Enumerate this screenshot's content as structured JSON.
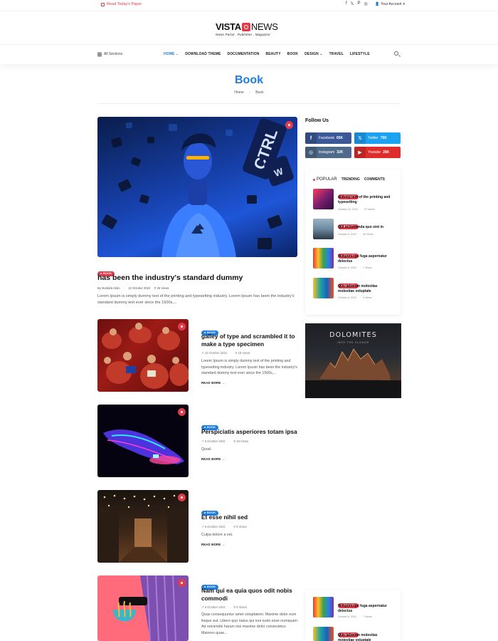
{
  "topbar": {
    "read_paper": "Read Today's Paper",
    "socials": [
      "f",
      "𝕏",
      "P",
      "◎"
    ],
    "account": "Your Account"
  },
  "logo": {
    "brand_left": "VISTA",
    "brand_right": "NEWS",
    "tagline": "News Portal . Publisher . Magazine"
  },
  "nav": {
    "all_sections": "All Sections",
    "items": [
      {
        "label": "HOME",
        "dropdown": true,
        "active": true
      },
      {
        "label": "DOWNLOAD THEME",
        "dropdown": false
      },
      {
        "label": "DOCUMENTATION",
        "dropdown": false
      },
      {
        "label": "BEAUTY",
        "dropdown": false
      },
      {
        "label": "BOOK",
        "dropdown": false
      },
      {
        "label": "DESIGN",
        "dropdown": true
      },
      {
        "label": "TRAVEL",
        "dropdown": false
      },
      {
        "label": "LIFESTYLE",
        "dropdown": false
      }
    ]
  },
  "page": {
    "title": "Book",
    "breadcrumb_home": "Home",
    "breadcrumb_current": "Book"
  },
  "featured": {
    "badge": "BOOK",
    "title": "has been the industry's standard dummy",
    "author": "By Mustafa Abdo",
    "date": "13 October 2024",
    "views": "25 Views",
    "excerpt": "Lorem Ipsum is simply dummy text of the printing and typesetting industry. Lorem Ipsum has been the industry's standard dummy text ever since the 1500s,...",
    "image_text": [
      "CTRL",
      "W"
    ]
  },
  "posts": [
    {
      "badge": "BOOK",
      "title": "galley of type and scrambled it to make a type specimen",
      "date": "13 October 2024",
      "views": "18 Views",
      "excerpt": "Lorem Ipsum is simply dummy text of the printing and typesetting industry. Lorem Ipsum has been the industry's standard dummy text ever since the 1500s,...",
      "read_more": "READ MORE"
    },
    {
      "badge": "BOOK",
      "title": "Perspiciatis asperiores totam ipsa",
      "date": "6 October 2024",
      "views": "18 Views",
      "excerpt": "Quod.",
      "read_more": "READ MORE"
    },
    {
      "badge": "BOOK",
      "title": "Et esse nihil sed",
      "date": "6 October 2024",
      "views": "8 Views",
      "excerpt": "Culpa dolore a est.",
      "read_more": "READ MORE"
    },
    {
      "badge": "BOOK",
      "title": "Nam qui ea quia quos odit nobis commodi",
      "date": "6 October 2024",
      "views": "8 Views",
      "excerpt": "Quas consequuntur amet voluptatem. Maxime dolor eum itaque aut. Libero quo natus qui iure iusto esse numquam. Ad reiciendis harum nisi maxime dolor consectetur. Maiores quae..."
    }
  ],
  "sidebar": {
    "follow_title": "Follow Us",
    "socials": [
      {
        "name": "Facebook",
        "count": "65K",
        "color": "#3b5998",
        "icon": "f"
      },
      {
        "name": "Twitter",
        "count": "75K",
        "color": "#1da1f2",
        "icon": "𝕏"
      },
      {
        "name": "Instagram",
        "count": "32K",
        "color": "#4f6a8a",
        "icon": "◎"
      },
      {
        "name": "Youtube",
        "count": "28K",
        "color": "#e02b2b",
        "icon": "▶"
      }
    ],
    "tabs": [
      "POPULAR",
      "TRENDING",
      "COMMENTS"
    ],
    "popular": [
      {
        "badge": "BEAUTY",
        "title": "dummy text of the printing and typesetting",
        "date": "October 13, 2024",
        "views": "57 Views"
      },
      {
        "badge": "BEAUTY",
        "title": "Qui assumenda quo sint in",
        "date": "October 6, 2024",
        "views": "46 Views"
      },
      {
        "badge": "BEAUTY",
        "title": "Tempora qui fuga aspernatur delectus",
        "date": "October 6, 2024",
        "views": "7 Views"
      },
      {
        "badge": "BEAUTY",
        "title": "Quo laborum molestias molestiae voluptate",
        "date": "October 6, 2024",
        "views": "4 Views"
      }
    ],
    "ad": {
      "title": "DOLOMITES",
      "subtitle": "INTO THE CLOUDS"
    },
    "bottom": [
      {
        "badge": "BEAUTY",
        "title": "Tempora qui fuga aspernatur delectus",
        "date": "October 6, 2024",
        "views": "7 Views"
      },
      {
        "badge": "BEAUTY",
        "title": "Quo laborum molestias molestiae voluptate"
      }
    ]
  }
}
